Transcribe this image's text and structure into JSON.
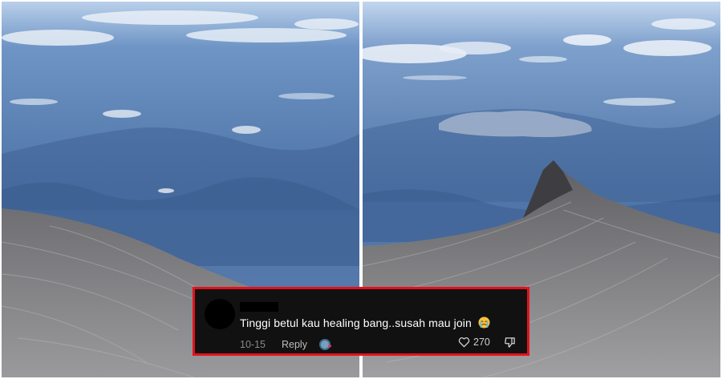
{
  "panels": {
    "left": {
      "subject": "view from mountain summit over cloud-dotted valleys"
    },
    "right": {
      "subject": "granite ridge leading to a rocky peak above valleys"
    }
  },
  "comment": {
    "username_redacted": true,
    "text": "Tinggi betul kau healing bang..susah mau join",
    "emoji_icon": "crying-face-icon",
    "date": "10-15",
    "reply_label": "Reply",
    "reaction_icon": "creator-avatar-heart-icon",
    "like_icon": "heart-outline-icon",
    "like_count": "270",
    "dislike_icon": "thumbs-down-outline-icon"
  },
  "colors": {
    "highlight_border": "#e3121b",
    "card_background": "#111111"
  }
}
